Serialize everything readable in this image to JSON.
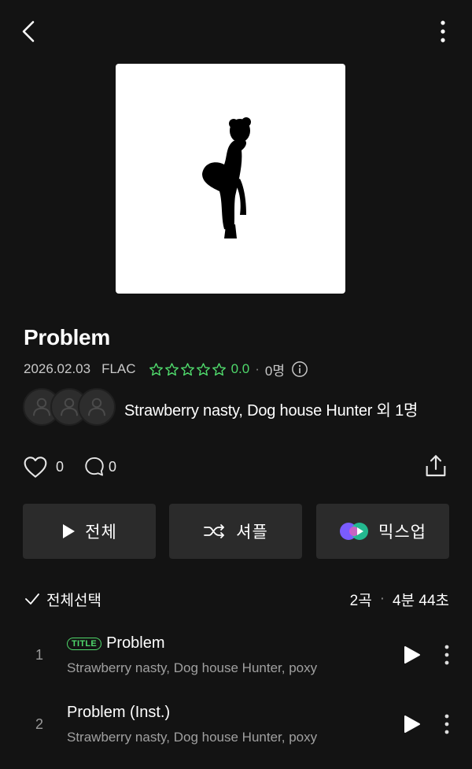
{
  "topbar": {
    "back_icon": "chevron-left-icon",
    "more_icon": "more-vertical-icon"
  },
  "album": {
    "title": "Problem",
    "release_date": "2026.02.03",
    "format": "FLAC",
    "rating": "0.0",
    "rating_count": "0명",
    "artists": "Strawberry nasty, Dog house Hunter 외 1명",
    "likes": "0",
    "comments": "0"
  },
  "actions": {
    "play_all": "전체",
    "shuffle": "셔플",
    "mixup": "믹스업"
  },
  "tracklist": {
    "select_all": "전체선택",
    "count": "2곡",
    "duration": "4분 44초",
    "tracks": [
      {
        "num": "1",
        "badge": "TITLE",
        "title": "Problem",
        "artists": "Strawberry nasty, Dog house Hunter, poxy"
      },
      {
        "num": "2",
        "badge": "",
        "title": "Problem (Inst.)",
        "artists": "Strawberry nasty, Dog house Hunter, poxy"
      }
    ]
  },
  "colors": {
    "background": "#131313",
    "accent_green": "#4fd86b",
    "button_bg": "#2b2b2b"
  }
}
